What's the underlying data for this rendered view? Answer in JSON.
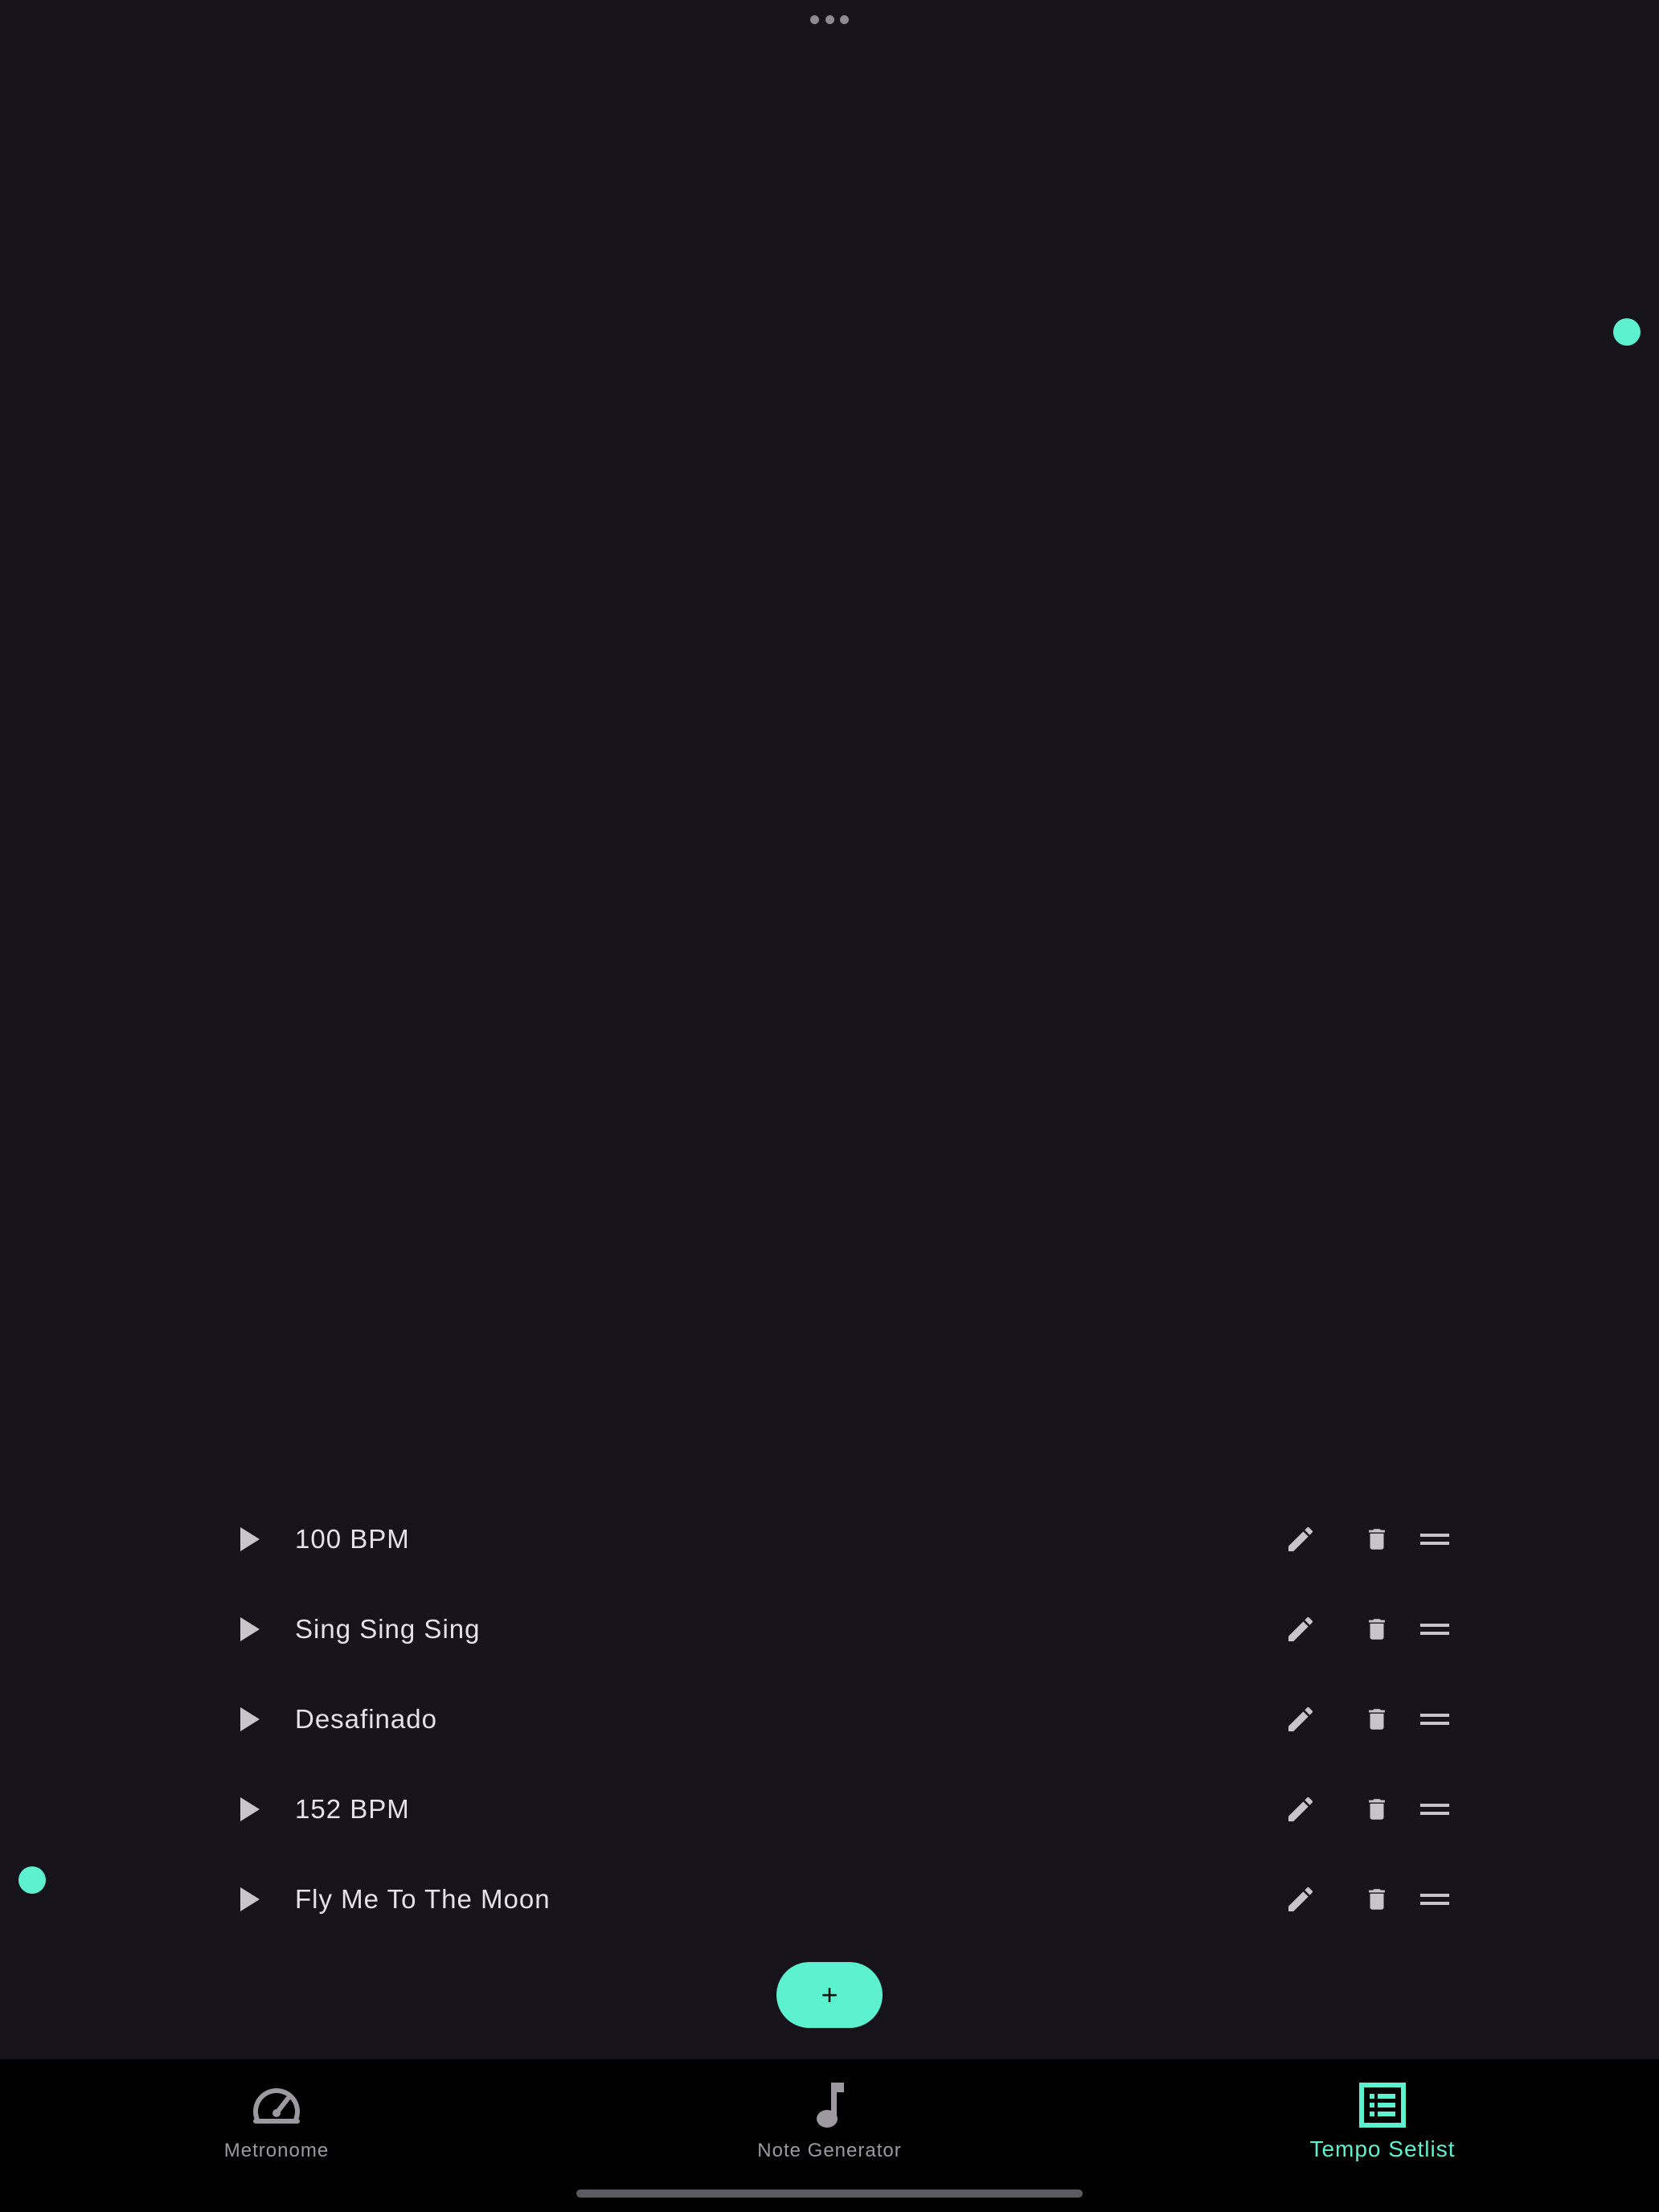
{
  "colors": {
    "background": "#16141a",
    "accent": "#5df2cf",
    "nav_background": "#000000",
    "text": "#e4e2e8",
    "icon": "#c7c5ca",
    "nav_inactive": "#9c9aa0"
  },
  "icons": {
    "row_play": "play-icon",
    "row_edit": "pencil-icon",
    "row_delete": "trash-icon",
    "row_drag": "drag-handle-icon",
    "add": "plus-icon",
    "more": "more-dots-icon"
  },
  "setlist": {
    "items": [
      {
        "title": "100 BPM"
      },
      {
        "title": "Sing Sing Sing"
      },
      {
        "title": "Desafinado"
      },
      {
        "title": "152 BPM"
      },
      {
        "title": "Fly Me To The Moon"
      }
    ],
    "add_label": "+"
  },
  "bottom_nav": {
    "items": [
      {
        "label": "Metronome",
        "icon": "speedometer-icon",
        "active": false
      },
      {
        "label": "Note Generator",
        "icon": "music-note-icon",
        "active": false
      },
      {
        "label": "Tempo Setlist",
        "icon": "list-icon",
        "active": true
      }
    ]
  }
}
